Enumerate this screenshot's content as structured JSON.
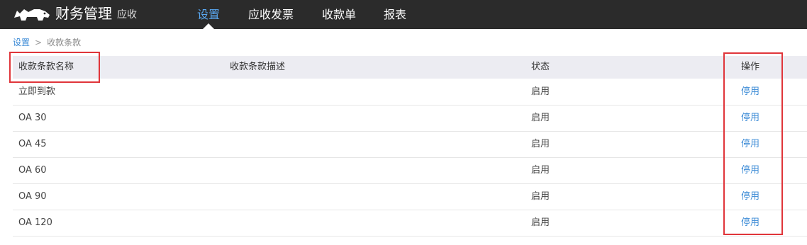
{
  "app": {
    "title": "财务管理",
    "module": "应收"
  },
  "nav": {
    "items": [
      "设置",
      "应收发票",
      "收款单",
      "报表"
    ]
  },
  "breadcrumb": {
    "root": "设置",
    "separator": ">",
    "current": "收款条款"
  },
  "table": {
    "columns": [
      "收款条款名称",
      "收款条款描述",
      "状态",
      "操作"
    ],
    "rows": [
      {
        "name": "立即到款",
        "description": "",
        "status": "启用",
        "action": "停用"
      },
      {
        "name": "OA 30",
        "description": "",
        "status": "启用",
        "action": "停用"
      },
      {
        "name": "OA 45",
        "description": "",
        "status": "启用",
        "action": "停用"
      },
      {
        "name": "OA 60",
        "description": "",
        "status": "启用",
        "action": "停用"
      },
      {
        "name": "OA 90",
        "description": "",
        "status": "启用",
        "action": "停用"
      },
      {
        "name": "OA 120",
        "description": "",
        "status": "启用",
        "action": "停用"
      }
    ]
  },
  "colors": {
    "topbar": "#2b2b2b",
    "accent": "#59a7f0",
    "link": "#3a8ad6",
    "highlight": "#e0353a"
  },
  "icons": {
    "logo": "rhino-logo-icon"
  }
}
